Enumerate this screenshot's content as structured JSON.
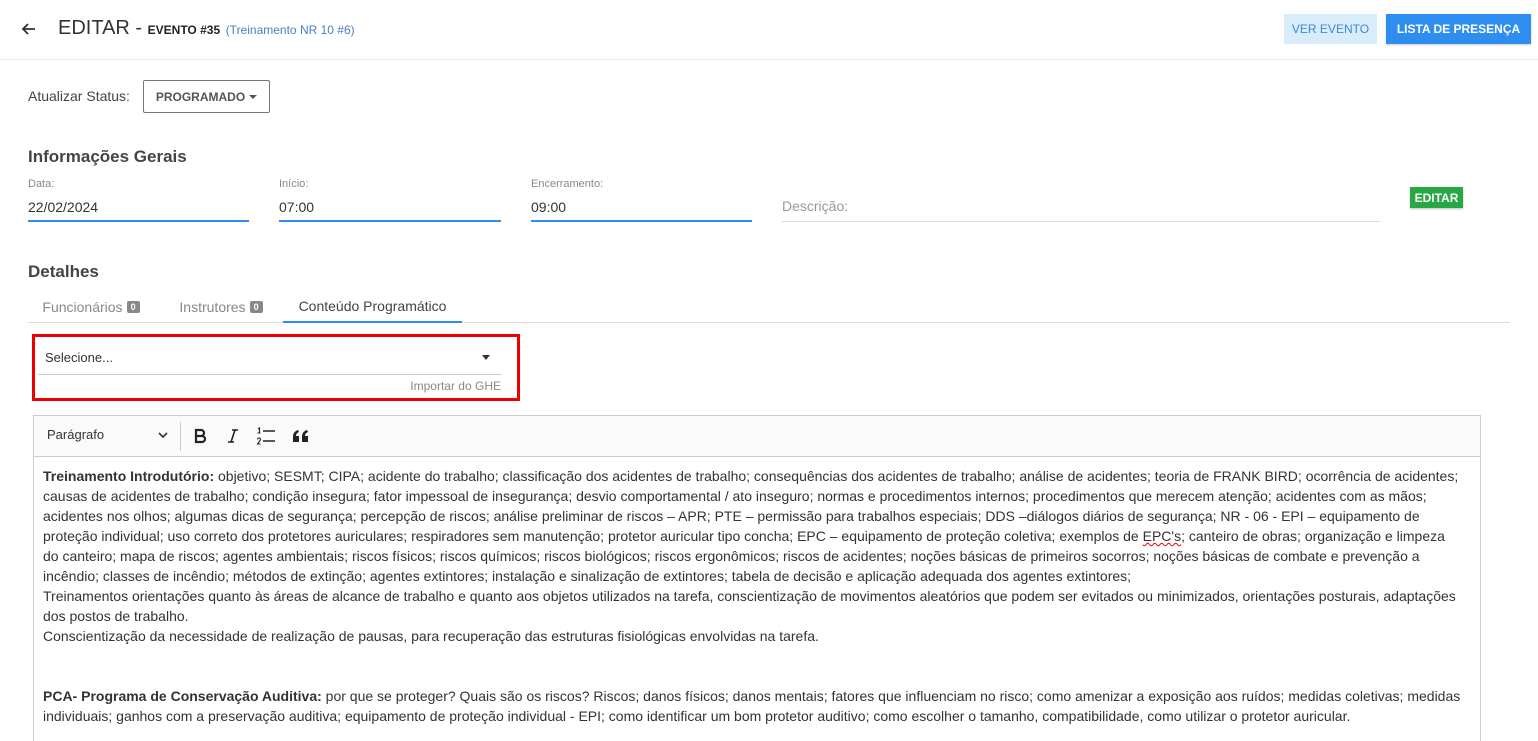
{
  "header": {
    "title": "EDITAR",
    "separator": " - ",
    "event_number": "EVENTO #35",
    "event_link": "(Treinamento NR 10 #6)",
    "ver_evento_label": "VER EVENTO",
    "lista_presenca_label": "LISTA DE PRESENÇA"
  },
  "status": {
    "label": "Atualizar Status:",
    "value": "PROGRAMADO"
  },
  "info": {
    "title": "Informações Gerais",
    "data_label": "Data:",
    "data_value": "22/02/2024",
    "inicio_label": "Início:",
    "inicio_value": "07:00",
    "encerramento_label": "Encerramento:",
    "encerramento_value": "09:00",
    "descricao_placeholder": "Descrição:",
    "editar_label": "EDITAR"
  },
  "details": {
    "title": "Detalhes",
    "tabs": [
      {
        "label": "Funcionários",
        "badge": "0"
      },
      {
        "label": "Instrutores",
        "badge": "0"
      },
      {
        "label": "Conteúdo Programático"
      }
    ]
  },
  "ghe": {
    "placeholder": "Selecione...",
    "helper": "Importar do GHE"
  },
  "editor": {
    "paragraph_select": "Parágrafo",
    "p1_bold": "Treinamento Introdutório:",
    "p1_text_a": "  objetivo; SESMT; CIPA; acidente do trabalho; classificação dos acidentes de trabalho; consequências dos acidentes de trabalho; análise de acidentes; teoria de FRANK BIRD; ocorrência de acidentes; causas de acidentes de trabalho; condição insegura; fator impessoal de insegurança; desvio comportamental / ato inseguro; normas e procedimentos internos; procedimentos que merecem atenção; acidentes com as mãos; acidentes nos olhos; algumas dicas de segurança; percepção de riscos; análise preliminar de riscos – APR; PTE – permissão para trabalhos especiais; DDS –diálogos diários de segurança; NR - 06 - EPI – equipamento de proteção individual; uso correto dos protetores auriculares; respiradores sem manutenção; protetor auricular tipo concha; EPC – equipamento de proteção coletiva; exemplos de ",
    "p1_squiggle": "EPC's",
    "p1_text_b": "; canteiro de obras; organização e limpeza do canteiro; mapa de riscos; agentes ambientais; riscos físicos; riscos químicos; riscos biológicos; riscos ergonômicos; riscos de acidentes; noções básicas de primeiros socorros; noções básicas de combate e prevenção a incêndio; classes de incêndio; métodos de extinção; agentes extintores; instalação e sinalização de extintores; tabela de decisão e aplicação adequada dos agentes extintores;",
    "p2": "Treinamentos orientações quanto às áreas de alcance de trabalho e quanto aos objetos utilizados na tarefa, conscientização de movimentos aleatórios que podem ser evitados ou minimizados, orientações posturais, adaptações dos postos de trabalho.",
    "p3": "Conscientização da necessidade de realização de pausas, para recuperação das estruturas fisiológicas envolvidas na tarefa.",
    "p4_bold": "PCA- Programa de Conservação Auditiva:",
    "p4_text": " por que se proteger? Quais são os riscos? Riscos; danos físicos; danos mentais; fatores que influenciam no risco; como amenizar a exposição aos ruídos; medidas coletivas; medidas individuais; ganhos com a preservação auditiva; equipamento de proteção individual - EPI; como identificar um bom protetor auditivo; como escolher o tamanho, compatibilidade, como utilizar o protetor auricular."
  },
  "colors": {
    "primary": "#2e8ef0",
    "success": "#28a745",
    "highlight_border": "#e00000"
  }
}
